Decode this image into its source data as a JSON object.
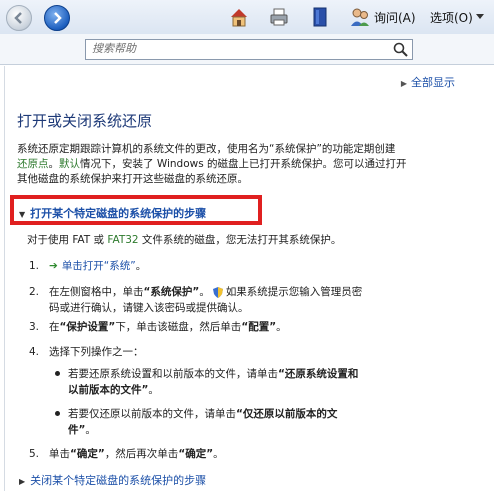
{
  "toolbar": {
    "ask_label": "询问(A)",
    "options_label": "选项(O)"
  },
  "search": {
    "placeholder": "搜索帮助"
  },
  "content": {
    "show_all": "全部显示",
    "title": "打开或关闭系统还原",
    "intro_line1": "系统还原定期跟踪计算机的系统文件的更改，使用名为“系统保护”的功能定期创建",
    "intro_link1": "还原点",
    "intro_sep": "。",
    "intro_link2": "默认",
    "intro_line2": "情况下，安装了 Windows 的磁盘上已打开系统保护。您可以通过打开",
    "intro_line3": "其他磁盘的系统保护来打开这些磁盘的系统还原。",
    "section_open": "打开某个特定磁盘的系统保护的步骤",
    "note_a": "对于使用 FAT 或 ",
    "note_link": "FAT32",
    "note_b": " 文件系统的磁盘，您无法打开其系统保护。",
    "steps": [
      {
        "num": "1.",
        "link": "单击打开“系统”",
        "tail": "。"
      },
      {
        "num": "2.",
        "a": "在左侧窗格中，单击",
        "b": "“系统保护”",
        "c": "。",
        "d": "如果系统提示您输入管理员密",
        "e": "码或进行确认，请键入该密码或提供确认。"
      },
      {
        "num": "3.",
        "a": "在",
        "b": "“保护设置”",
        "c": "下，单击该磁盘，然后单击",
        "d": "“配置”",
        "e": "。"
      },
      {
        "num": "4.",
        "a": "选择下列操作之一："
      },
      {
        "num": "5.",
        "a": "单击",
        "b": "“确定”",
        "c": "，然后再次单击",
        "d": "“确定”",
        "e": "。"
      }
    ],
    "bullets": [
      {
        "a": "若要还原系统设置和以前版本的文件，请单击",
        "b": "“还原系统设置和",
        "c": "以前版本的文件”",
        "d": "。"
      },
      {
        "a": "若要仅还原以前版本的文件，请单击",
        "b": "“仅还原以前版本的文",
        "c": "件”",
        "d": "。"
      }
    ],
    "section_close": "关闭某个特定磁盘的系统保护的步骤"
  }
}
